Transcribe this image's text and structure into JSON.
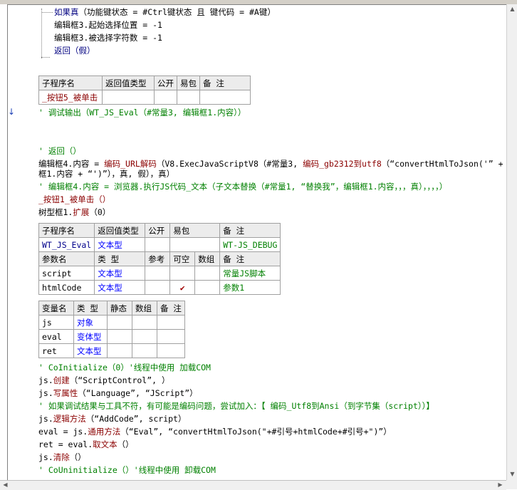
{
  "lines": {
    "l1_kw": "如果真",
    "l1_rest": "（功能键状态 = #Ctrl键状态 且 键代码 = #A键）",
    "l2": "编辑框3.起始选择位置 = -1",
    "l3": "编辑框3.被选择字符数 = -1",
    "l4_kw": "返回",
    "l4_rest": "（假）",
    "l5": "' 调试输出（WT_JS_Eval（#常量3, 编辑框1.内容））",
    "l6": "' 返回（）",
    "l7a_1": "编辑框4.内容 = ",
    "l7a_2": "编码_URL解码",
    "l7a_3": "（V8.ExecJavaScriptV8（#常量3, ",
    "l7a_4": "编码_gb2312到utf8",
    "l7a_5": "（“convertHtmlToJson('” + 编辑",
    "l7b": "框1.内容 + “')”），真, 假），真）",
    "l8": "' 编辑框4.内容 = 浏览器.执行JS代码_文本（子文本替换（#常量1, “替换我”，编辑框1.内容，，，真），，，，）",
    "l9": "_按钮1_被单击（）",
    "l10_1": "树型框1.",
    "l10_2": "扩展",
    "l10_3": "（0）",
    "l11": "' CoInitialize（0）'线程中使用 加载COM",
    "l12_1": "js.",
    "l12_2": "创建",
    "l12_3": "（“ScriptControl”, ）",
    "l13_1": "js.",
    "l13_2": "写属性",
    "l13_3": "（“Language”, “JScript”）",
    "l14": "' 如果调试结果与工具不符，有可能是编码问题，尝试加入：【 编码_Utf8到Ansi（到字节集（script））】",
    "l15_1": "js.",
    "l15_2": "逻辑方法",
    "l15_3": "（“AddCode”, script）",
    "l16_1": "eval = js.",
    "l16_2": "通用方法",
    "l16_3": "（“Eval”, “convertHtmlToJson(\"+#引号+htmlCode+#引号+\")”）",
    "l17_1": "ret = eval.",
    "l17_2": "取文本",
    "l17_3": "（）",
    "l18_1": "js.",
    "l18_2": "清除",
    "l18_3": "（）",
    "l19": "' CoUninitialize（）'线程中使用 卸载COM"
  },
  "table1": {
    "headers": [
      "子程序名",
      "返回值类型",
      "公开",
      "易包",
      "备 注"
    ],
    "row": [
      "_按钮5_被单击",
      "",
      "",
      "",
      ""
    ]
  },
  "table2": {
    "headers": [
      "子程序名",
      "返回值类型",
      "公开",
      "易包",
      "备 注"
    ],
    "row": [
      "WT_JS_Eval",
      "文本型",
      "",
      "",
      "WT-JS_DEBUG"
    ],
    "param_headers": [
      "参数名",
      "类 型",
      "参考",
      "可空",
      "数组",
      "备 注"
    ],
    "params": [
      [
        "script",
        "文本型",
        "",
        "",
        "",
        "常量JS脚本"
      ],
      [
        "htmlCode",
        "文本型",
        "",
        "✔",
        "",
        "参数1"
      ]
    ]
  },
  "table3": {
    "headers": [
      "变量名",
      "类 型",
      "静态",
      "数组",
      "备 注"
    ],
    "rows": [
      [
        "js",
        "对象",
        "",
        "",
        ""
      ],
      [
        "eval",
        "变体型",
        "",
        "",
        ""
      ],
      [
        "ret",
        "文本型",
        "",
        "",
        ""
      ]
    ]
  }
}
